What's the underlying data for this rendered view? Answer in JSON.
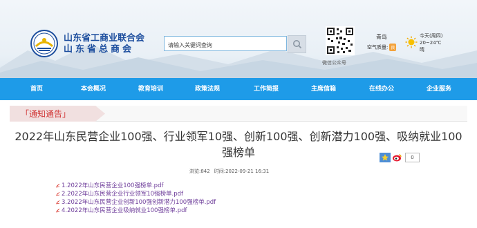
{
  "header": {
    "org_name_line1": "山东省工商业联合会",
    "org_name_line2": "山东省总商会",
    "search_placeholder": "请输入关键词查询",
    "qr_label": "微信公众号",
    "weather": {
      "city": "青岛",
      "air_quality_label": "空气质量:",
      "air_quality_value": "良",
      "day": "今天(周四)",
      "temp": "20~24℃",
      "condition": "晴"
    }
  },
  "nav": {
    "items": [
      "首页",
      "本会概况",
      "教育培训",
      "政策法规",
      "工作简报",
      "主席信箱",
      "在线办公",
      "企业服务"
    ]
  },
  "section": {
    "label": "「通知通告」"
  },
  "article": {
    "title": "2022年山东民营企业100强、行业领军10强、创新100强、创新潜力100强、吸纳就业100强榜单",
    "views": "浏览:842",
    "time": "时间:2022-09-21 16:31",
    "counter": "0",
    "attachments": [
      "1.2022年山东民营企业100强榜单.pdf",
      "2.2022年山东民营企业行业领军10强榜单.pdf",
      "3.2022年山东民营企业创新100强创新潜力100强榜单.pdf",
      "4.2022年山东民营企业吸纳就业100强榜单.pdf"
    ]
  },
  "colors": {
    "nav": "#1e9be8",
    "brand": "#1d4e9e",
    "link": "#6e3d9a",
    "section": "#d23a3a"
  }
}
